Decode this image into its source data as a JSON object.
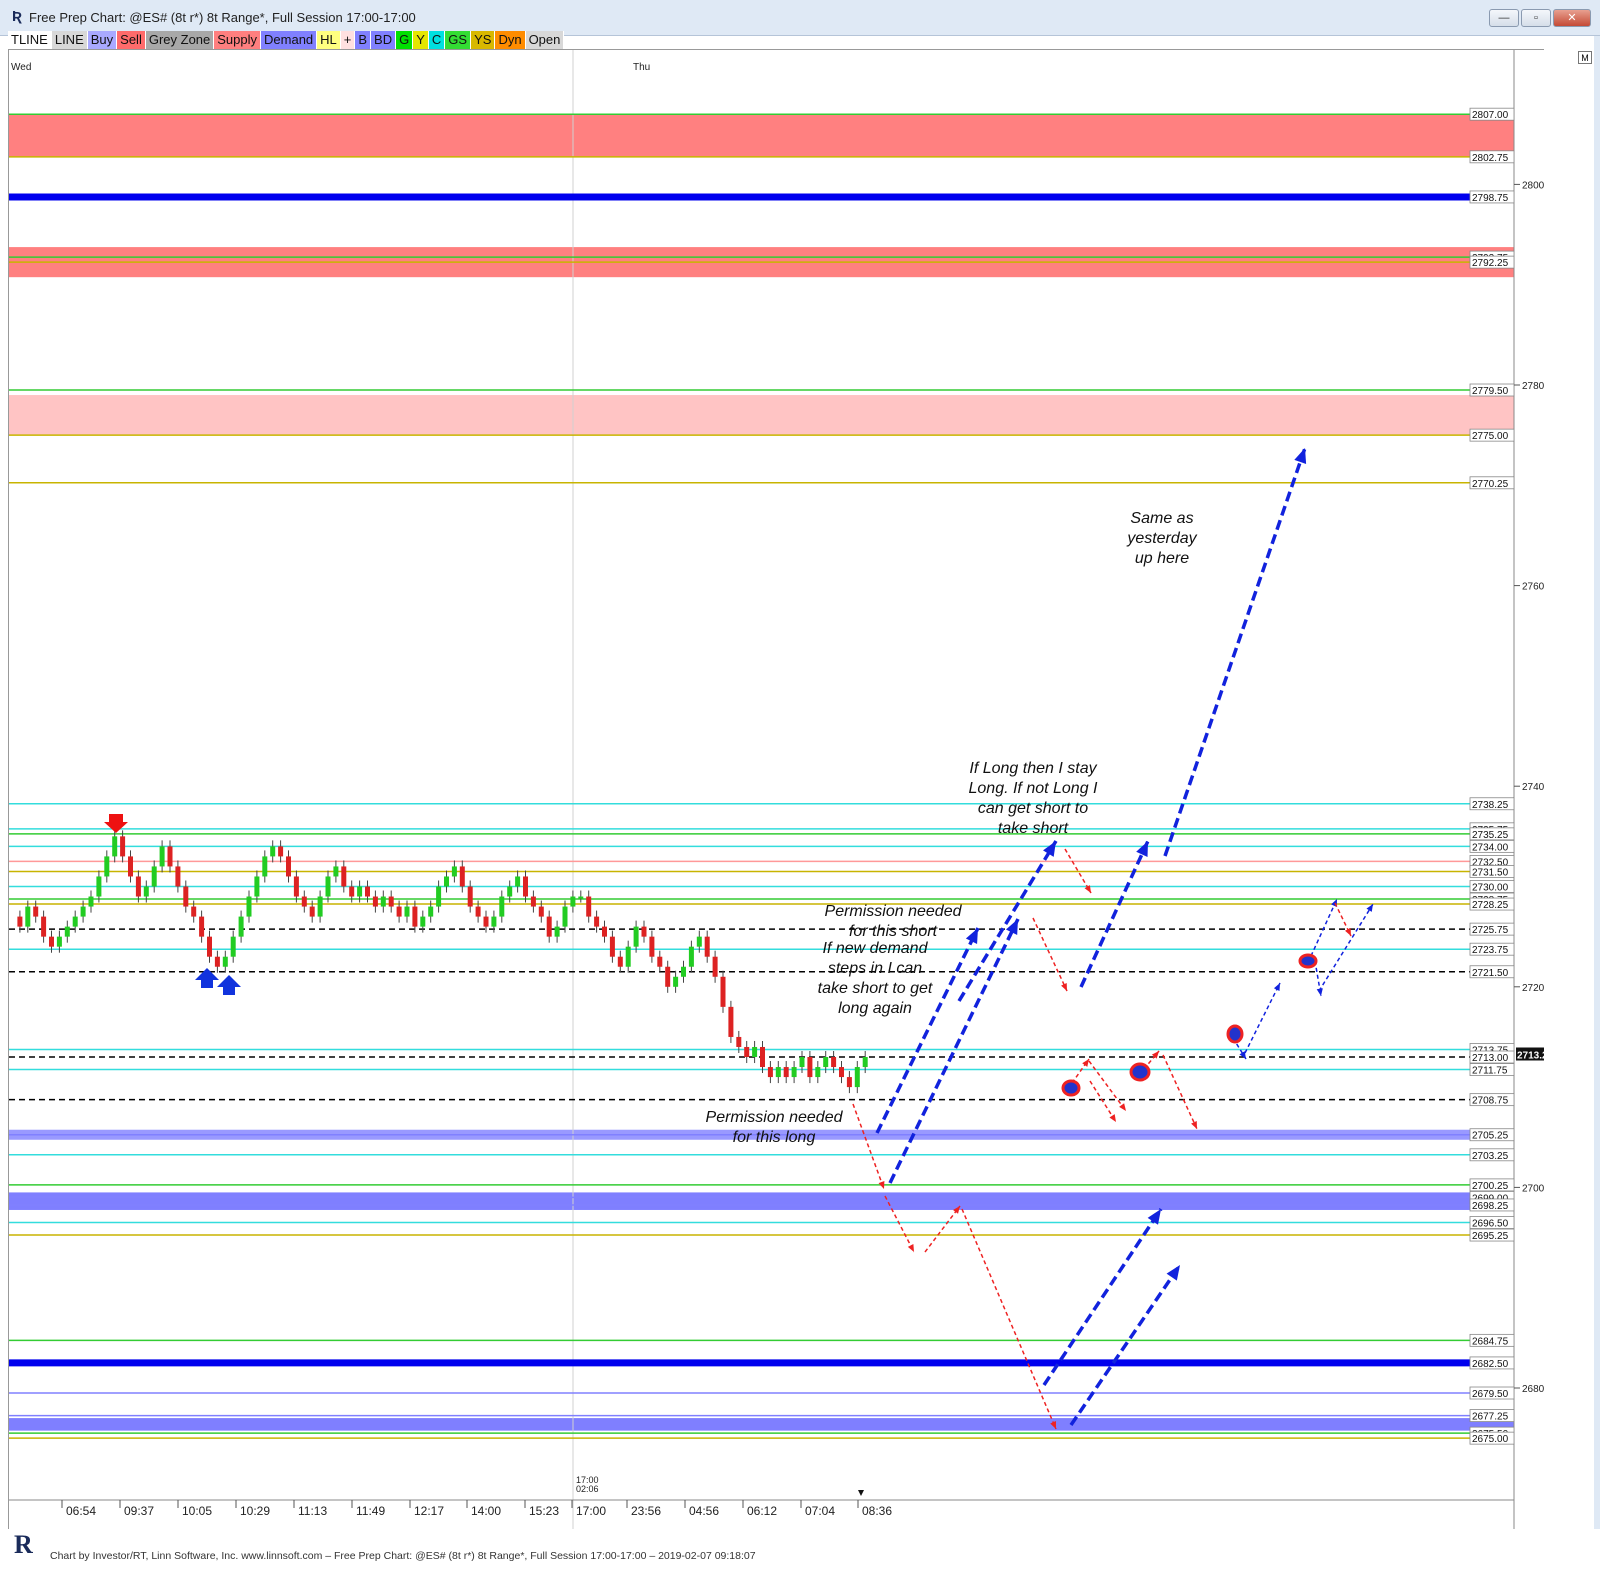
{
  "window": {
    "title": "Free Prep Chart: @ES# (8t r*) 8t Range*, Full Session 17:00-17:00",
    "min_label": "—",
    "max_label": "▫",
    "close_label": "✕"
  },
  "toolbar": [
    {
      "label": "TLINE",
      "bg": "#ffffff"
    },
    {
      "label": "LINE",
      "bg": "#d8d8d8"
    },
    {
      "label": "Buy",
      "bg": "#a9a9ff"
    },
    {
      "label": "Sell",
      "bg": "#ff6b6b"
    },
    {
      "label": "Grey Zone",
      "bg": "#a8a8a8"
    },
    {
      "label": "Supply",
      "bg": "#ff7f7f"
    },
    {
      "label": "Demand",
      "bg": "#8080ff"
    },
    {
      "label": "HL",
      "bg": "#ffff80"
    },
    {
      "label": "+",
      "bg": "#ffe0e0"
    },
    {
      "label": "B",
      "bg": "#8080ff"
    },
    {
      "label": "BD",
      "bg": "#8080ff"
    },
    {
      "label": "G",
      "bg": "#00e000"
    },
    {
      "label": "Y",
      "bg": "#e6e600"
    },
    {
      "label": "C",
      "bg": "#00e0e0"
    },
    {
      "label": "GS",
      "bg": "#33dd33"
    },
    {
      "label": "YS",
      "bg": "#d8b800"
    },
    {
      "label": "Dyn",
      "bg": "#ff8c00"
    },
    {
      "label": "Open",
      "bg": "#d8d8d8"
    }
  ],
  "chart": {
    "day_labels": [
      "Wed",
      "Thu"
    ],
    "m_label": "M",
    "scale_ticks": [
      "2800",
      "2780",
      "2760",
      "2740",
      "2720",
      "2700",
      "2680"
    ],
    "time_labels": [
      "06:54",
      "09:37",
      "10:05",
      "10:29",
      "11:13",
      "11:49",
      "12:17",
      "14:00",
      "15:23",
      "17:00",
      "23:56",
      "04:56",
      "06:12",
      "07:04",
      "08:36"
    ],
    "session_marker": "17:00\n02:06",
    "session_marker_time": "17:00",
    "session_marker_date": "02:06",
    "current_price": "2713.25",
    "levels": [
      {
        "price": 2807.0,
        "label": "2807.00",
        "color": "#33cc33"
      },
      {
        "price": 2802.75,
        "label": "2802.75",
        "color": "#c8b400"
      },
      {
        "price": 2798.75,
        "label": "2798.75",
        "color": "#0000ee"
      },
      {
        "price": 2792.75,
        "label": "2792.75",
        "color": "#33cc33"
      },
      {
        "price": 2792.25,
        "label": "2792.25",
        "color": "#c8b400"
      },
      {
        "price": 2779.5,
        "label": "2779.50",
        "color": "#33cc33"
      },
      {
        "price": 2775.0,
        "label": "2775.00",
        "color": "#c8b400"
      },
      {
        "price": 2770.25,
        "label": "2770.25",
        "color": "#c8b400"
      },
      {
        "price": 2738.25,
        "label": "2738.25",
        "color": "#33dddd"
      },
      {
        "price": 2735.75,
        "label": "2735.75",
        "color": "#33dddd"
      },
      {
        "price": 2735.25,
        "label": "2735.25",
        "color": "#33cc33"
      },
      {
        "price": 2734.0,
        "label": "2734.00",
        "color": "#33dddd"
      },
      {
        "price": 2732.5,
        "label": "2732.50",
        "color": "#ff9999"
      },
      {
        "price": 2731.5,
        "label": "2731.50",
        "color": "#c8b400"
      },
      {
        "price": 2730.0,
        "label": "2730.00",
        "color": "#33dddd"
      },
      {
        "price": 2728.75,
        "label": "2728.75",
        "color": "#33cc33"
      },
      {
        "price": 2728.25,
        "label": "2728.25",
        "color": "#c8b400"
      },
      {
        "price": 2725.75,
        "label": "2725.75",
        "color": "#000000"
      },
      {
        "price": 2723.75,
        "label": "2723.75",
        "color": "#33dddd"
      },
      {
        "price": 2721.5,
        "label": "2721.50",
        "color": "#000000"
      },
      {
        "price": 2713.75,
        "label": "2713.75",
        "color": "#33dddd"
      },
      {
        "price": 2713.0,
        "label": "2713.00",
        "color": "#000000"
      },
      {
        "price": 2711.75,
        "label": "2711.75",
        "color": "#33dddd"
      },
      {
        "price": 2708.75,
        "label": "2708.75",
        "color": "#000000"
      },
      {
        "price": 2705.25,
        "label": "2705.25",
        "color": "#8080ff"
      },
      {
        "price": 2703.25,
        "label": "2703.25",
        "color": "#33dddd"
      },
      {
        "price": 2700.25,
        "label": "2700.25",
        "color": "#33cc33"
      },
      {
        "price": 2699.0,
        "label": "2699.00",
        "color": "#8080ff"
      },
      {
        "price": 2698.25,
        "label": "2698.25",
        "color": "#8080ff"
      },
      {
        "price": 2696.5,
        "label": "2696.50",
        "color": "#33dddd"
      },
      {
        "price": 2695.25,
        "label": "2695.25",
        "color": "#c8b400"
      },
      {
        "price": 2684.75,
        "label": "2684.75",
        "color": "#33cc33"
      },
      {
        "price": 2682.5,
        "label": "2682.50",
        "color": "#0000ee"
      },
      {
        "price": 2679.5,
        "label": "2679.50",
        "color": "#8080ff"
      },
      {
        "price": 2677.25,
        "label": "2677.25",
        "color": "#8080ff"
      },
      {
        "price": 2675.5,
        "label": "2675.50",
        "color": "#33cc33"
      },
      {
        "price": 2675.0,
        "label": "2675.00",
        "color": "#c8b400"
      }
    ],
    "zones": [
      {
        "top": 2807.0,
        "bottom": 2802.75,
        "color": "#ff8080"
      },
      {
        "top": 2793.75,
        "bottom": 2790.75,
        "color": "#ff8080"
      },
      {
        "top": 2779.0,
        "bottom": 2775.0,
        "color": "#ffc4c4"
      },
      {
        "top": 2705.75,
        "bottom": 2704.75,
        "color": "#9999ff"
      },
      {
        "top": 2699.5,
        "bottom": 2697.75,
        "color": "#7f7fff"
      },
      {
        "top": 2677.0,
        "bottom": 2675.75,
        "color": "#7f7fff"
      }
    ],
    "annotations": {
      "same_as_yesterday": [
        "Same as",
        "yesterday",
        "up here"
      ],
      "if_long": [
        "If Long then I stay",
        "Long. If not Long I",
        "can get short to",
        "take short"
      ],
      "permission_short": [
        "Permission needed",
        "for this  short"
      ],
      "new_demand": [
        "If new demand",
        "steps in I can",
        "take short to get",
        "long again"
      ],
      "permission_long": [
        "Permission needed",
        "for this long"
      ]
    }
  },
  "footer": {
    "logo": "R",
    "text": "Chart by Investor/RT, Linn Software, Inc. www.linnsoft.com – Free Prep Chart: @ES# (8t r*) 8t Range*, Full Session 17:00-17:00 – 2019-02-07 09:18:07"
  }
}
